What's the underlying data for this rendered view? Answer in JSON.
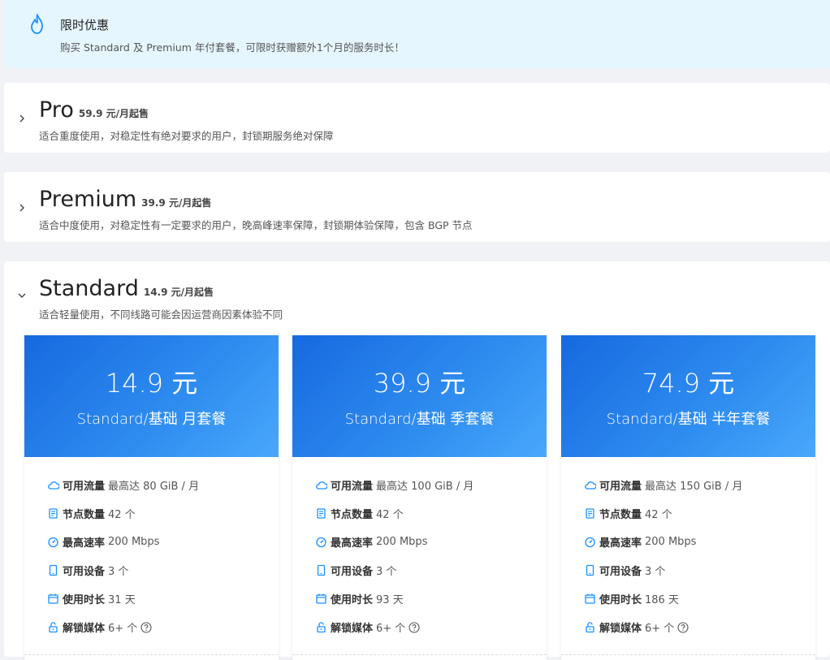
{
  "banner": {
    "title": "限时优惠",
    "desc": "购买 Standard 及 Premium 年付套餐，可限时获赠额外1个月的服务时长！"
  },
  "plans": [
    {
      "name": "Pro",
      "price_hint": "59.9 元/月起售",
      "desc": "适合重度使用，对稳定性有绝对要求的用户，封锁期服务绝对保障",
      "expanded": false
    },
    {
      "name": "Premium",
      "price_hint": "39.9 元/月起售",
      "desc": "适合中度使用，对稳定性有一定要求的用户，晚高峰速率保障，封锁期体验保障，包含 BGP 节点",
      "expanded": false
    },
    {
      "name": "Standard",
      "price_hint": "14.9 元/月起售",
      "desc": "适合轻量使用，不同线路可能会因运营商因素体验不同",
      "expanded": true
    }
  ],
  "tiers": [
    {
      "price": "14.9 元",
      "name": "Standard/基础 月套餐",
      "features": [
        {
          "icon": "cloud-icon",
          "label": "可用流量",
          "value": "最高达 80 GiB / 月"
        },
        {
          "icon": "server-icon",
          "label": "节点数量",
          "value": "42 个"
        },
        {
          "icon": "speedometer-icon",
          "label": "最高速率",
          "value": "200 Mbps"
        },
        {
          "icon": "tablet-icon",
          "label": "可用设备",
          "value": "3 个"
        },
        {
          "icon": "calendar-icon",
          "label": "使用时长",
          "value": "31 天"
        },
        {
          "icon": "unlock-icon",
          "label": "解锁媒体",
          "value": "6+ 个"
        }
      ]
    },
    {
      "price": "39.9 元",
      "name": "Standard/基础 季套餐",
      "features": [
        {
          "icon": "cloud-icon",
          "label": "可用流量",
          "value": "最高达 100 GiB / 月"
        },
        {
          "icon": "server-icon",
          "label": "节点数量",
          "value": "42 个"
        },
        {
          "icon": "speedometer-icon",
          "label": "最高速率",
          "value": "200 Mbps"
        },
        {
          "icon": "tablet-icon",
          "label": "可用设备",
          "value": "3 个"
        },
        {
          "icon": "calendar-icon",
          "label": "使用时长",
          "value": "93 天"
        },
        {
          "icon": "unlock-icon",
          "label": "解锁媒体",
          "value": "6+ 个"
        }
      ]
    },
    {
      "price": "74.9 元",
      "name": "Standard/基础 半年套餐",
      "features": [
        {
          "icon": "cloud-icon",
          "label": "可用流量",
          "value": "最高达 150 GiB / 月"
        },
        {
          "icon": "server-icon",
          "label": "节点数量",
          "value": "42 个"
        },
        {
          "icon": "speedometer-icon",
          "label": "最高速率",
          "value": "200 Mbps"
        },
        {
          "icon": "tablet-icon",
          "label": "可用设备",
          "value": "3 个"
        },
        {
          "icon": "calendar-icon",
          "label": "使用时长",
          "value": "186 天"
        },
        {
          "icon": "unlock-icon",
          "label": "解锁媒体",
          "value": "6+ 个"
        }
      ]
    }
  ],
  "colors": {
    "accent": "#1890ff",
    "tier_head_start": "#1769df",
    "tier_head_end": "#49a8fb",
    "banner_bg": "#e6f6ff"
  }
}
